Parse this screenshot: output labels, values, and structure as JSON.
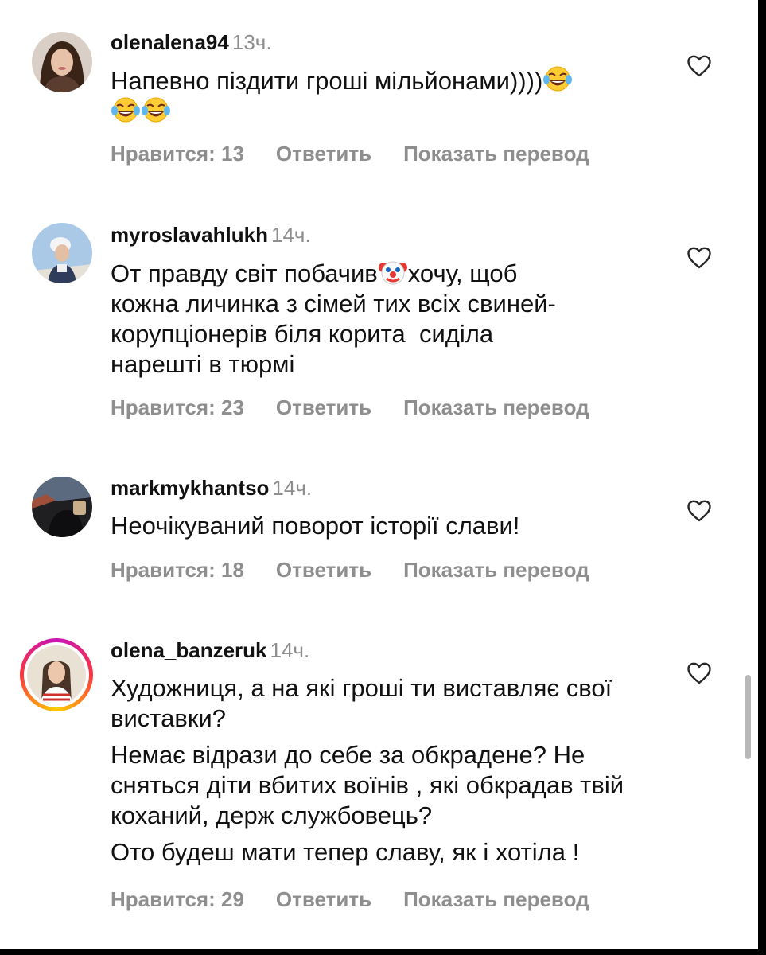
{
  "labels": {
    "like_prefix": "Нравится: ",
    "reply": "Ответить",
    "translate": "Показать перевод"
  },
  "comments": [
    {
      "username": "olenalena94",
      "time": "13ч.",
      "paragraphs": [
        "Напевно піздити гроші мільйонами))))"
      ],
      "emoji": [
        "laughing-tears",
        "laughing-tears",
        "laughing-tears"
      ],
      "likes": "Нравится: 13"
    },
    {
      "username": "myroslavahlukh",
      "time": "14ч.",
      "line1a": "От правду світ побачив",
      "line1b": "хочу, щоб",
      "line2": "кожна личинка з сімей тих всіх свиней-",
      "line3": "корупціонерів біля корита  сиділа",
      "line4": "нарешті в тюрмі",
      "emoji": [
        "clown"
      ],
      "likes": "Нравится: 23"
    },
    {
      "username": "markmykhantso",
      "time": "14ч.",
      "paragraphs": [
        "Неочікуваний поворот історії слави!"
      ],
      "likes": "Нравится: 18"
    },
    {
      "username": "olena_banzeruk",
      "time": "14ч.",
      "paragraphs": [
        "Художниця, а на які гроші ти виставляє свої виставки?",
        "Немає відрази до себе за обкрадене? Не сняться діти вбитих воїнів , які обкрадав твій коханий, держ службовець?",
        "Ото будеш мати тепер славу, як і хотіла !"
      ],
      "likes": "Нравится: 29"
    }
  ],
  "colors": {
    "username": "#111111",
    "secondary": "#8e8e8e",
    "story_ring": [
      "#c913b9",
      "#f9373f",
      "#fecd00"
    ]
  }
}
